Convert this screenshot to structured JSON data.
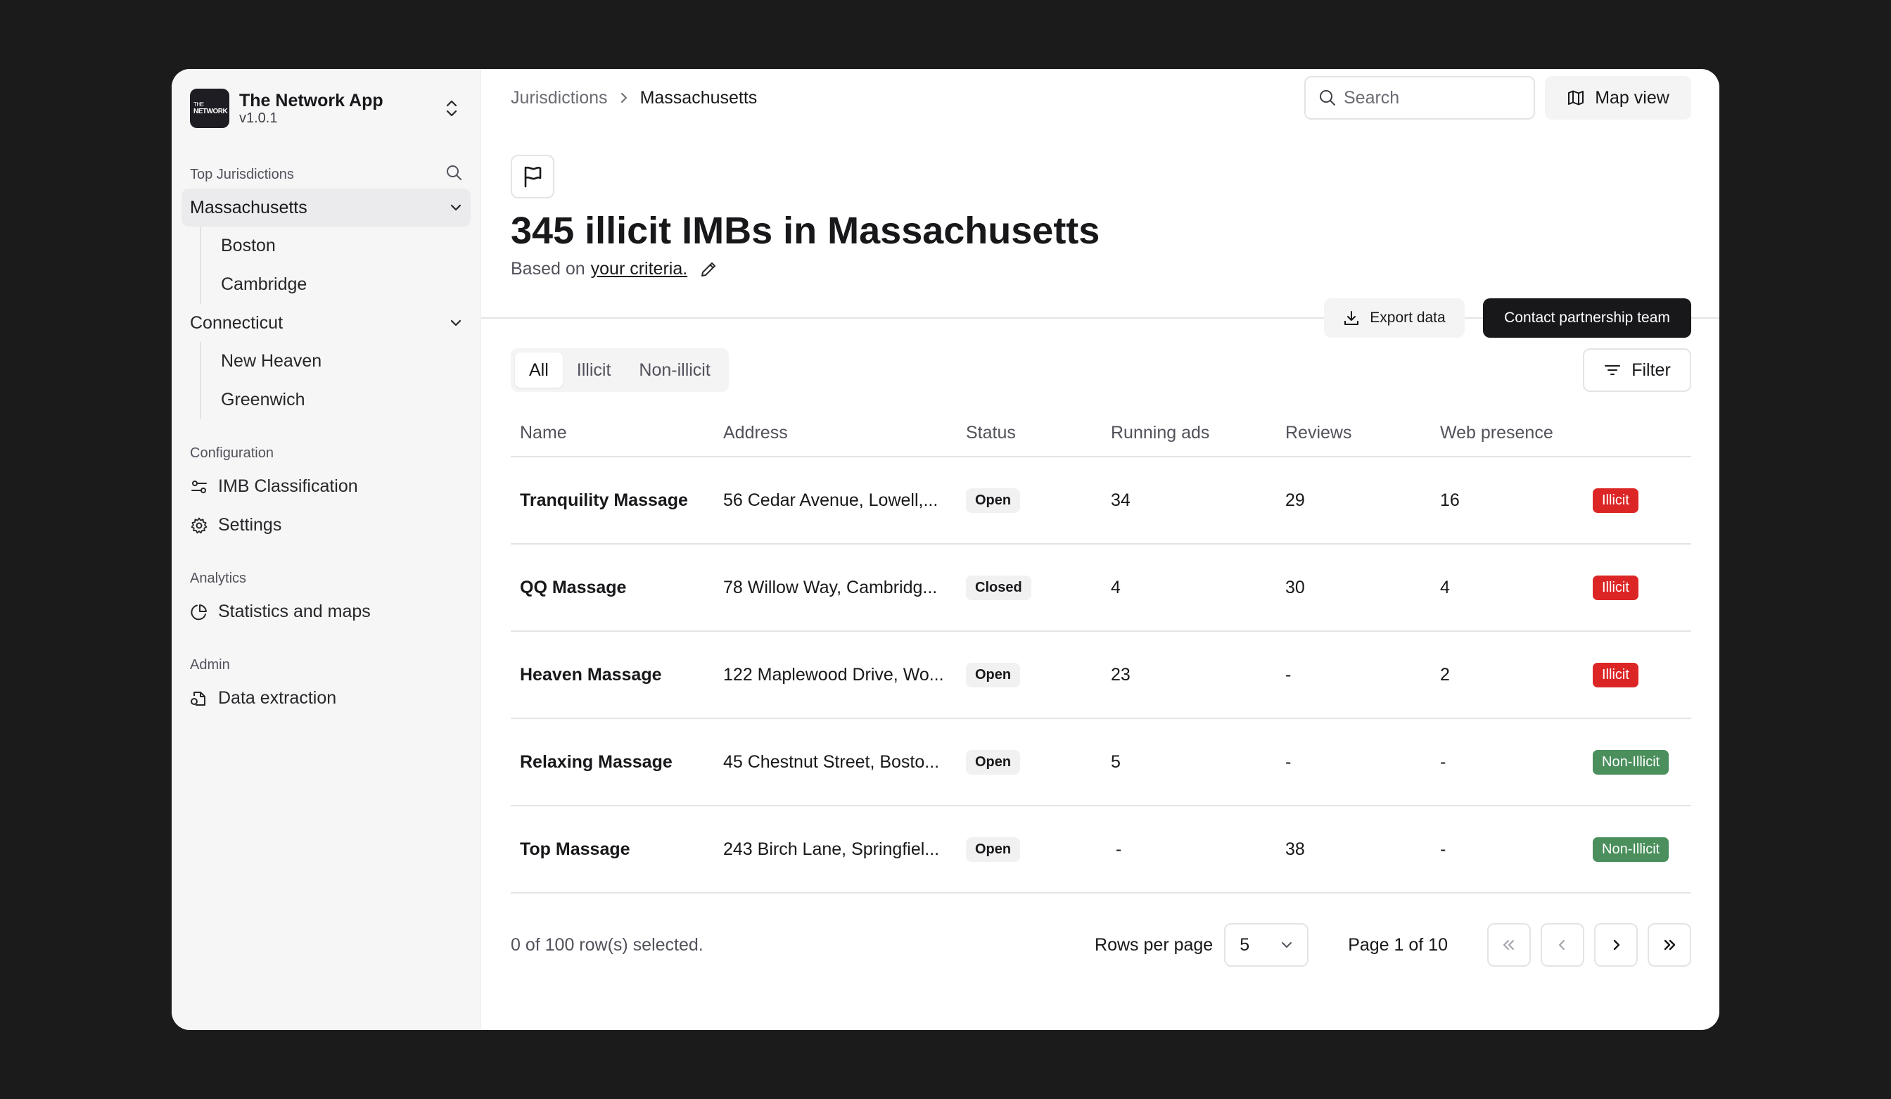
{
  "app": {
    "name": "The Network App",
    "version": "v1.0.1",
    "logo_line1": "THE",
    "logo_line2": "NETWORK"
  },
  "sidebar": {
    "top_label": "Top Jurisdictions",
    "jurisdictions": [
      {
        "label": "Massachusetts",
        "children": [
          "Boston",
          "Cambridge"
        ]
      },
      {
        "label": "Connecticut",
        "children": [
          "New Heaven",
          "Greenwich"
        ]
      }
    ],
    "configuration_label": "Configuration",
    "configuration_items": [
      "IMB Classification",
      "Settings"
    ],
    "analytics_label": "Analytics",
    "analytics_items": [
      "Statistics and maps"
    ],
    "admin_label": "Admin",
    "admin_items": [
      "Data extraction"
    ]
  },
  "breadcrumb": [
    "Jurisdictions",
    "Massachusetts"
  ],
  "search": {
    "placeholder": "Search",
    "value": ""
  },
  "map_view_label": "Map view",
  "headline": {
    "bold": "345 illicit IMBs",
    "rest": " in Massachusetts"
  },
  "criteria": {
    "prefix": "Based on",
    "link": "your criteria."
  },
  "actions": {
    "export": "Export data",
    "contact": "Contact partnership team"
  },
  "tabs": [
    "All",
    "Illicit",
    "Non-illicit"
  ],
  "filter_label": "Filter",
  "table": {
    "headers": [
      "Name",
      "Address",
      "Status",
      "Running ads",
      "Reviews",
      "Web presence",
      ""
    ],
    "rows": [
      {
        "name": "Tranquility Massage",
        "address": "56 Cedar Avenue, Lowell,...",
        "status": "Open",
        "ads": "34",
        "reviews": "29",
        "web": "16",
        "class": "Illicit",
        "kind": "illicit"
      },
      {
        "name": "QQ Massage",
        "address": "78 Willow Way, Cambridg...",
        "status": "Closed",
        "ads": "4",
        "reviews": "30",
        "web": "4",
        "class": "Illicit",
        "kind": "illicit"
      },
      {
        "name": "Heaven Massage",
        "address": "122 Maplewood Drive, Wo...",
        "status": "Open",
        "ads": "23",
        "reviews": "-",
        "web": "2",
        "class": "Illicit",
        "kind": "illicit"
      },
      {
        "name": "Relaxing Massage",
        "address": "45 Chestnut Street, Bosto...",
        "status": "Open",
        "ads": "5",
        "reviews": "-",
        "web": "-",
        "class": "Non-Illicit",
        "kind": "non"
      },
      {
        "name": "Top Massage",
        "address": "243 Birch Lane, Springfiel...",
        "status": "Open",
        "ads": " -",
        "reviews": "38",
        "web": "-",
        "class": "Non-Illicit",
        "kind": "non"
      }
    ]
  },
  "footer": {
    "selected": "0 of 100 row(s) selected.",
    "rows_per_page_label": "Rows per page",
    "rows_per_page": "5",
    "page_info": "Page 1 of 10"
  },
  "colors": {
    "illicit": "#dc2626",
    "non_illicit": "#4a8f5c",
    "primary": "#18181b"
  }
}
